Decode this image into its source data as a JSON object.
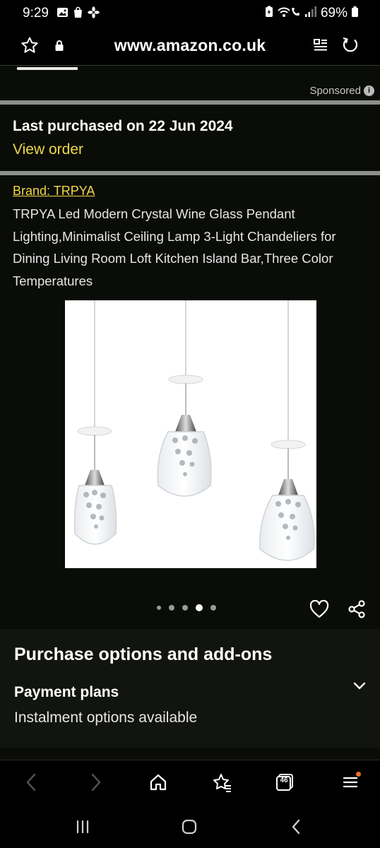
{
  "status_bar": {
    "time": "9:29",
    "battery": "69%",
    "left_icons": [
      "gallery-icon",
      "shopping-bag-icon",
      "fan-icon"
    ],
    "right_icons": [
      "battery-saver-icon",
      "wifi-calling-icon",
      "signal-icon",
      "battery-icon"
    ]
  },
  "browser": {
    "url": "www.amazon.co.uk",
    "left_icons": [
      "star-outline-icon",
      "lock-icon"
    ],
    "right_icons": [
      "reader-mode-icon",
      "reload-icon"
    ]
  },
  "sponsored_label": "Sponsored",
  "purchase_banner": {
    "last_purchased": "Last purchased on 22 Jun 2024",
    "view_order": "View order"
  },
  "product": {
    "brand": "Brand: TRPYA",
    "title": "TRPYA Led Modern Crystal Wine Glass Pendant Lighting,Minimalist Ceiling Lamp 3-Light Chandeliers for Dining Living Room Loft Kitchen Island Bar,Three Color Temperatures",
    "image_count": 5,
    "active_image": 4
  },
  "options": {
    "title": "Purchase options and add-ons",
    "payment_plans": "Payment plans",
    "instalment": "Instalment options available"
  },
  "bottom_nav": {
    "items": [
      "back-icon",
      "forward-icon",
      "home-icon",
      "bookmarks-icon",
      "tabs-icon",
      "menu-icon"
    ],
    "tab_count": "46"
  },
  "system_nav": {
    "items": [
      "recents-icon",
      "home-button-icon",
      "system-back-icon"
    ]
  },
  "colors": {
    "accent_link": "#f0d74a",
    "background": "#0a0c08",
    "divider": "#8d8f8b"
  }
}
